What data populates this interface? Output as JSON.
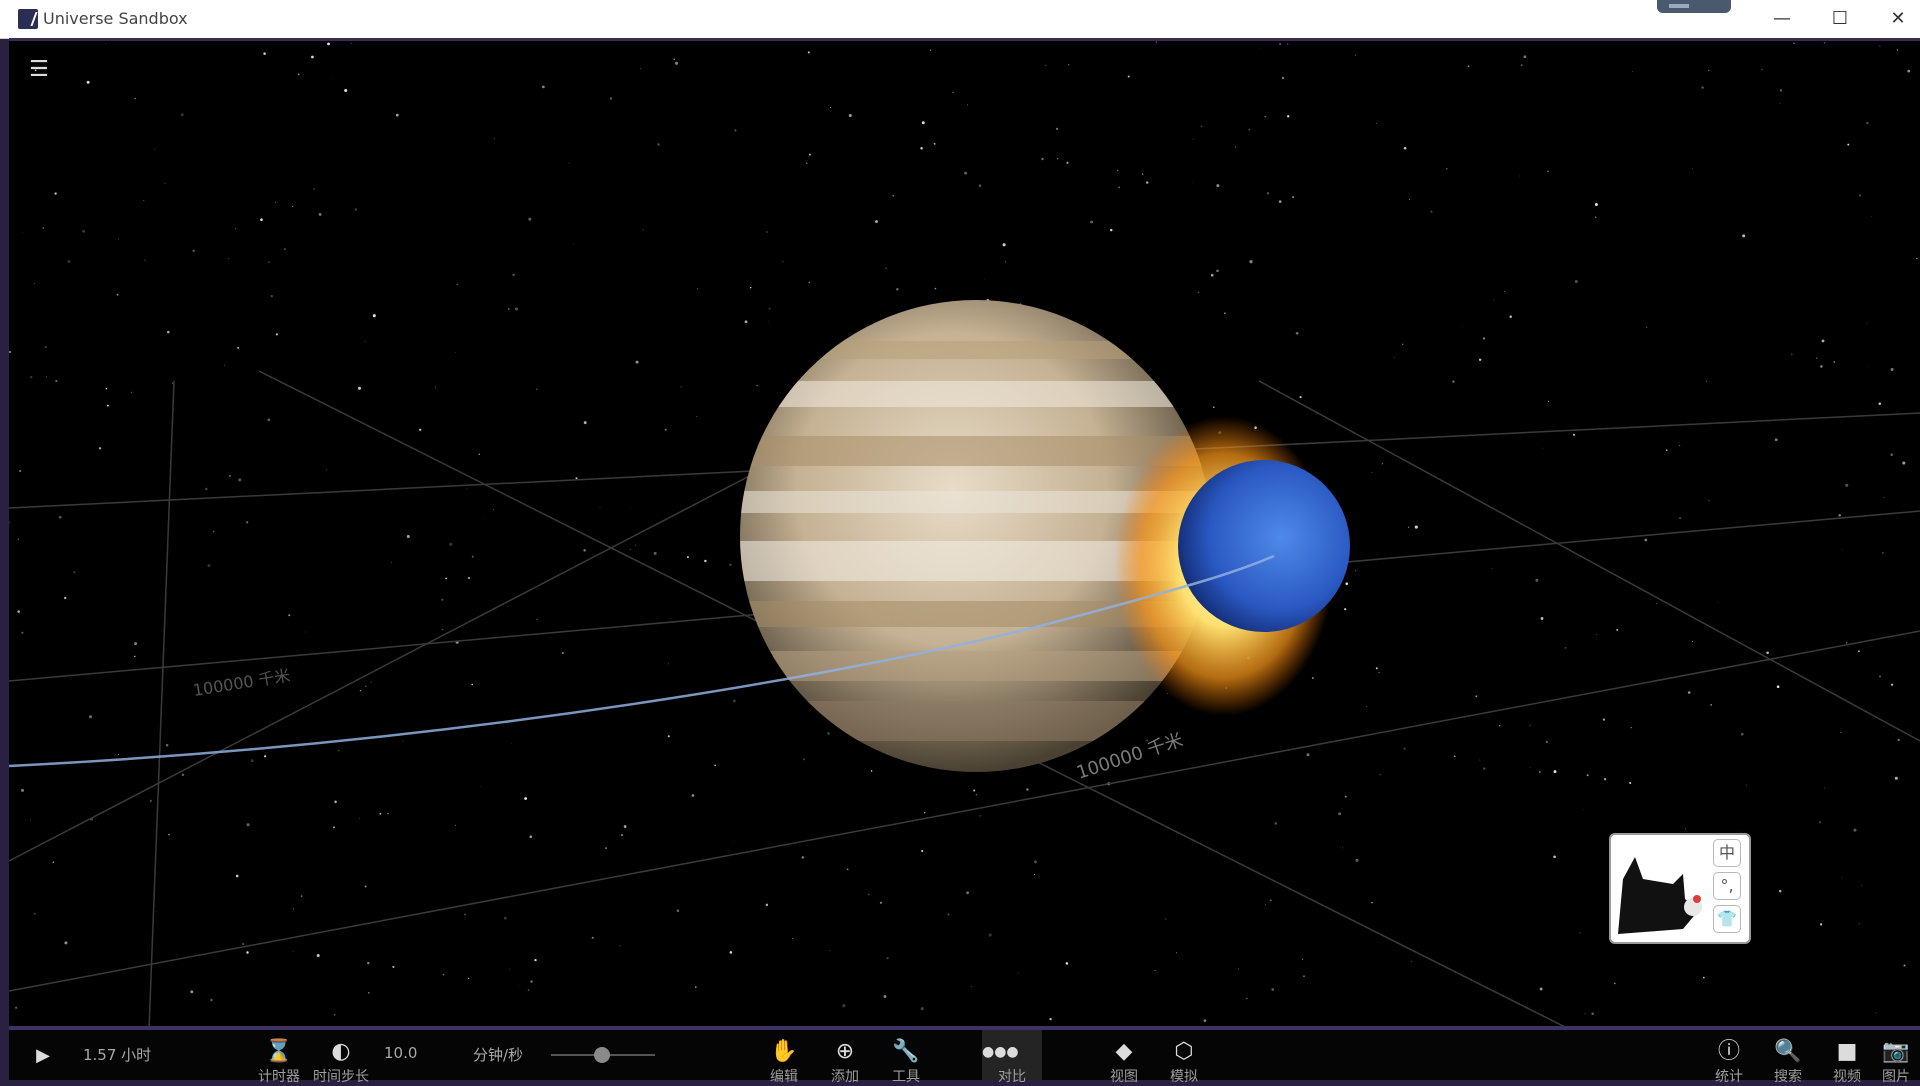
{
  "window": {
    "title": "Universe Sandbox",
    "controls": {
      "minimize": "—",
      "maximize": "☐",
      "close": "✕"
    }
  },
  "viewport": {
    "menu_icon": "hamburger-menu-icon",
    "grid_labels": [
      "100000 千米",
      "100000 千米"
    ]
  },
  "ime_widget": {
    "buttons": [
      "中",
      "°,",
      "👕"
    ]
  },
  "bottom_bar": {
    "elapsed_time": "1.57 小时",
    "timestep_value": "10.0",
    "speed_unit": "分钟/秒",
    "left_tools": [
      {
        "id": "timer",
        "label": "计时器",
        "icon": "hourglass-icon"
      },
      {
        "id": "timestep",
        "label": "时间步长",
        "icon": "timestep-icon"
      }
    ],
    "center_tools": [
      {
        "id": "edit",
        "label": "编辑",
        "icon": "hand-icon"
      },
      {
        "id": "add",
        "label": "添加",
        "icon": "plus-circle-icon"
      },
      {
        "id": "tools",
        "label": "工具",
        "icon": "wrench-icon"
      },
      {
        "id": "compare",
        "label": "对比",
        "icon": "dots-icon",
        "active": true
      },
      {
        "id": "view",
        "label": "视图",
        "icon": "layers-icon"
      },
      {
        "id": "sim",
        "label": "模拟",
        "icon": "cube-icon"
      }
    ],
    "right_tools": [
      {
        "id": "stats",
        "label": "统计",
        "icon": "info-icon"
      },
      {
        "id": "search",
        "label": "搜索",
        "icon": "search-icon"
      },
      {
        "id": "video",
        "label": "视频",
        "icon": "video-camera-icon"
      },
      {
        "id": "photo",
        "label": "图片",
        "icon": "camera-icon"
      }
    ]
  },
  "colors": {
    "accent_border": "#3d3260",
    "viewport_bg": "#000000",
    "gas_giant": "#c9b89a",
    "blue_planet": "#2f63cf",
    "impact_glow": "#ffd24a",
    "orbit_line": "#7f9ccf"
  }
}
